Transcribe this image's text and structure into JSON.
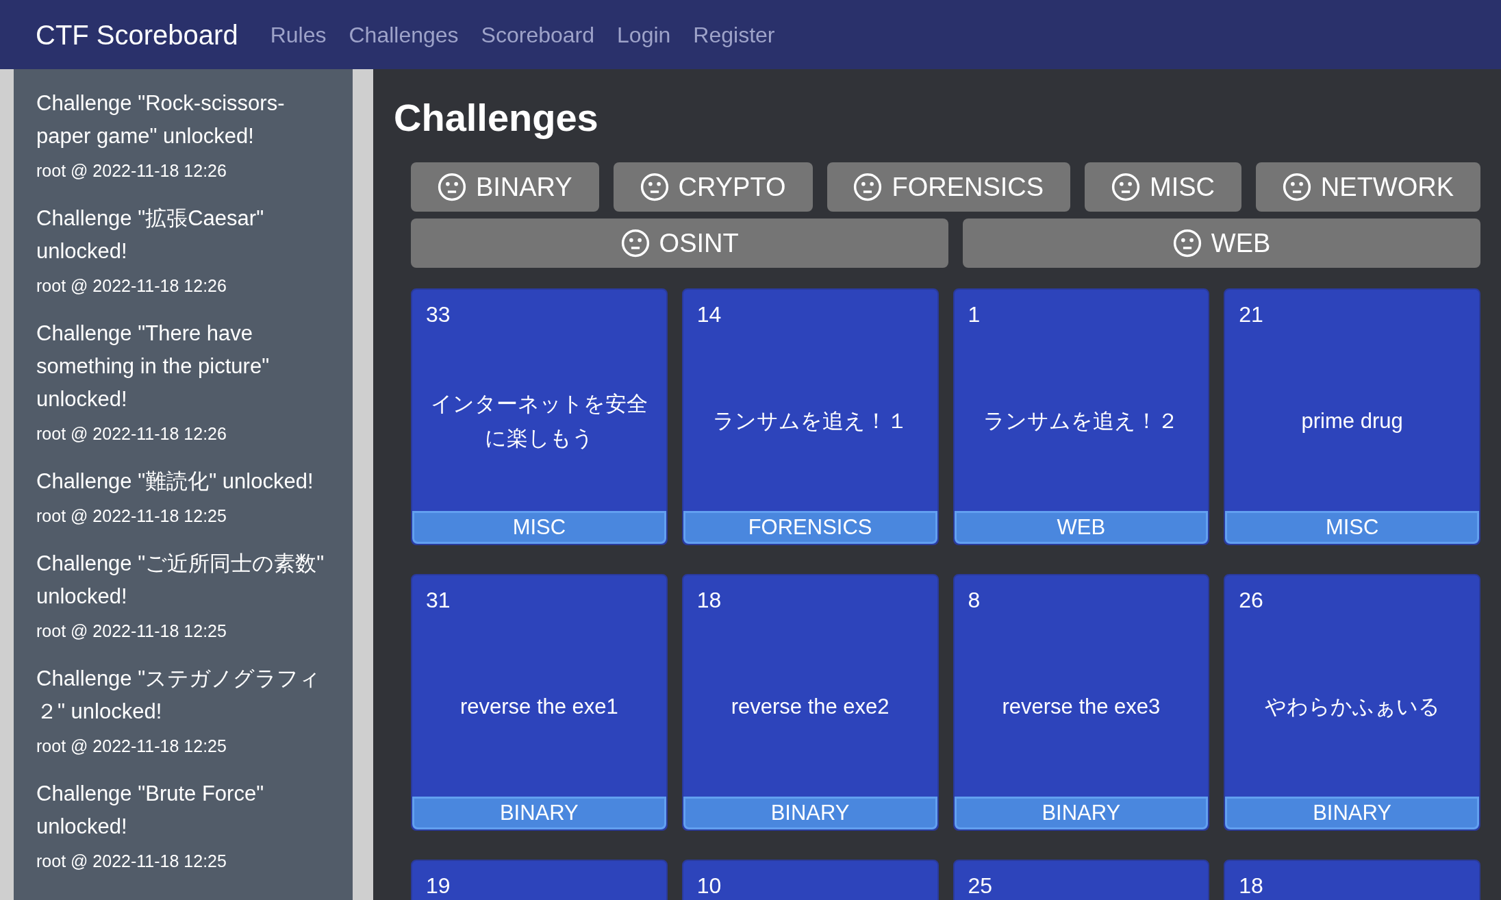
{
  "navbar": {
    "brand": "CTF Scoreboard",
    "links": [
      "Rules",
      "Challenges",
      "Scoreboard",
      "Login",
      "Register"
    ]
  },
  "sidebar": {
    "notifications": [
      {
        "message": "Challenge \"Rock-scissors-paper game\" unlocked!",
        "meta": "root @ 2022-11-18 12:26"
      },
      {
        "message": "Challenge \"拡張Caesar\" unlocked!",
        "meta": "root @ 2022-11-18 12:26"
      },
      {
        "message": "Challenge \"There have something in the picture\" unlocked!",
        "meta": "root @ 2022-11-18 12:26"
      },
      {
        "message": "Challenge \"難読化\" unlocked!",
        "meta": "root @ 2022-11-18 12:25"
      },
      {
        "message": "Challenge \"ご近所同士の素数\" unlocked!",
        "meta": "root @ 2022-11-18 12:25"
      },
      {
        "message": "Challenge \"ステガノグラフィ２\" unlocked!",
        "meta": "root @ 2022-11-18 12:25"
      },
      {
        "message": "Challenge \"Brute Force\" unlocked!",
        "meta": "root @ 2022-11-18 12:25"
      }
    ]
  },
  "main": {
    "title": "Challenges",
    "category_filters": [
      [
        "BINARY",
        "CRYPTO",
        "FORENSICS",
        "MISC",
        "NETWORK"
      ],
      [
        "OSINT",
        "WEB"
      ]
    ],
    "challenges": [
      {
        "points": "33",
        "name": "インターネットを安全に楽しもう",
        "category": "MISC"
      },
      {
        "points": "14",
        "name": "ランサムを追え！１",
        "category": "FORENSICS"
      },
      {
        "points": "1",
        "name": "ランサムを追え！２",
        "category": "WEB"
      },
      {
        "points": "21",
        "name": "prime drug",
        "category": "MISC"
      },
      {
        "points": "31",
        "name": "reverse the exe1",
        "category": "BINARY"
      },
      {
        "points": "18",
        "name": "reverse the exe2",
        "category": "BINARY"
      },
      {
        "points": "8",
        "name": "reverse the exe3",
        "category": "BINARY"
      },
      {
        "points": "26",
        "name": "やわらかふぁいる",
        "category": "BINARY"
      },
      {
        "points": "19"
      },
      {
        "points": "10"
      },
      {
        "points": "25"
      },
      {
        "points": "18"
      }
    ]
  }
}
